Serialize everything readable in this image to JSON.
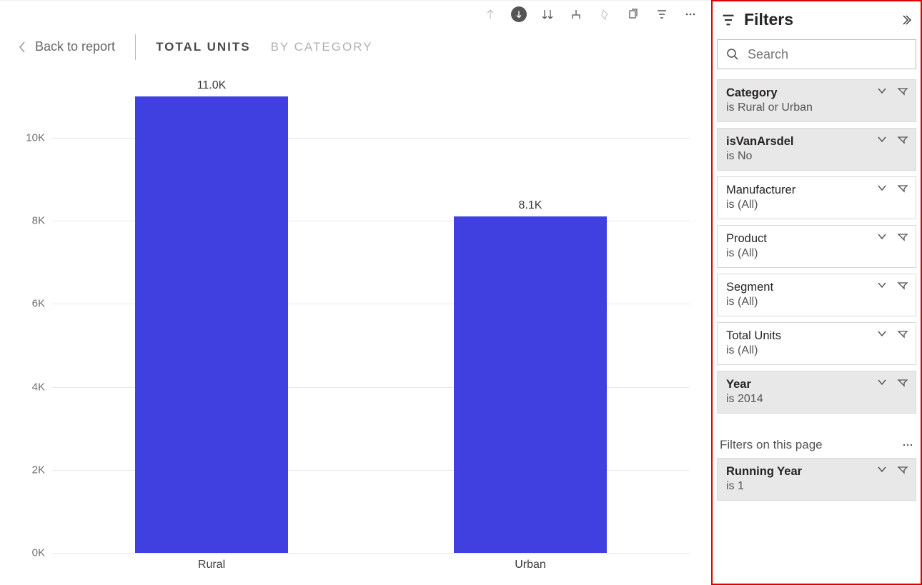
{
  "nav": {
    "back_label": "Back to report",
    "tabs": [
      {
        "label": "TOTAL UNITS",
        "active": true
      },
      {
        "label": "BY CATEGORY",
        "active": false
      }
    ]
  },
  "chart_data": {
    "type": "bar",
    "categories": [
      "Rural",
      "Urban"
    ],
    "values": [
      11000,
      8100
    ],
    "value_labels": [
      "11.0K",
      "8.1K"
    ],
    "ytick_labels": [
      "0K",
      "2K",
      "4K",
      "6K",
      "8K",
      "10K"
    ],
    "ytick_values": [
      0,
      2000,
      4000,
      6000,
      8000,
      10000
    ],
    "ylim": [
      0,
      11200
    ],
    "bar_color": "#4040e0"
  },
  "filters": {
    "title": "Filters",
    "search_placeholder": "Search",
    "page_section_label": "Filters on this page",
    "visual_filters": [
      {
        "name": "Category",
        "value": "is Rural or Urban",
        "applied": true
      },
      {
        "name": "isVanArsdel",
        "value": "is No",
        "applied": true
      },
      {
        "name": "Manufacturer",
        "value": "is (All)",
        "applied": false
      },
      {
        "name": "Product",
        "value": "is (All)",
        "applied": false
      },
      {
        "name": "Segment",
        "value": "is (All)",
        "applied": false
      },
      {
        "name": "Total Units",
        "value": "is (All)",
        "applied": false
      },
      {
        "name": "Year",
        "value": "is 2014",
        "applied": true
      }
    ],
    "page_filters": [
      {
        "name": "Running Year",
        "value": "is 1",
        "applied": true
      }
    ]
  }
}
